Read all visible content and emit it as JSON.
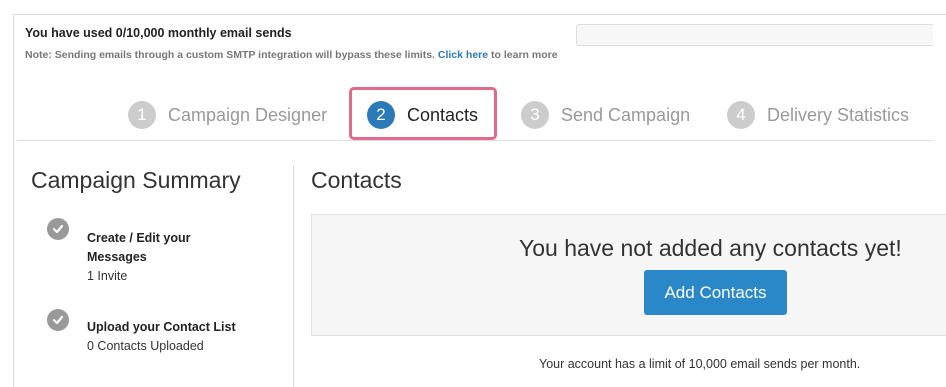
{
  "usage": {
    "title": "You have used 0/10,000 monthly email sends",
    "note_prefix": "Note: Sending emails through a custom SMTP integration will bypass these limits.",
    "note_link": "Click here",
    "note_suffix": "to learn more"
  },
  "steps": [
    {
      "num": "1",
      "label": "Campaign Designer"
    },
    {
      "num": "2",
      "label": "Contacts"
    },
    {
      "num": "3",
      "label": "Send Campaign"
    },
    {
      "num": "4",
      "label": "Delivery Statistics"
    }
  ],
  "active_step": 1,
  "summary": {
    "title": "Campaign Summary",
    "items": [
      {
        "heading": "Create / Edit your Messages",
        "detail": "1 Invite"
      },
      {
        "heading": "Upload your Contact List",
        "detail": "0 Contacts Uploaded"
      }
    ]
  },
  "contacts": {
    "title": "Contacts",
    "empty_message": "You have not added any contacts yet!",
    "add_button": "Add Contacts",
    "limit_note": "Your account has a limit of 10,000 email sends per month."
  },
  "colors": {
    "accent": "#2a7ab8",
    "button": "#2a88c8",
    "highlight": "#e06a8a",
    "step_inactive": "#cccccc"
  }
}
